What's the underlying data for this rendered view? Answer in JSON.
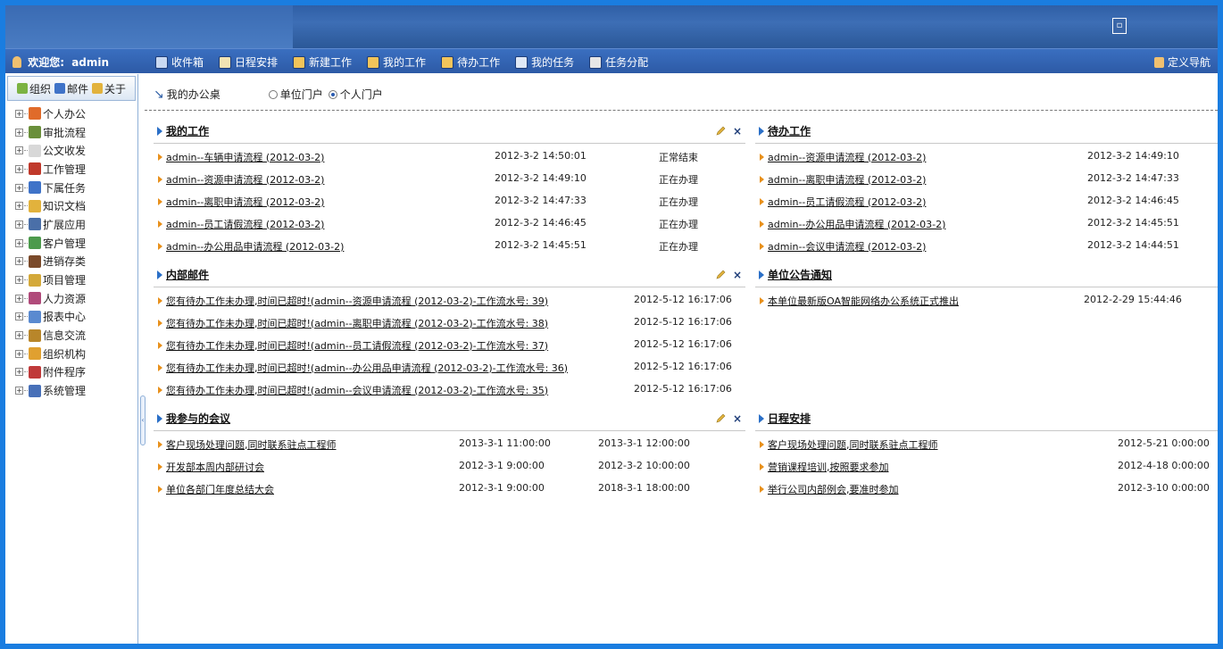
{
  "header": {
    "window_btn": "▫"
  },
  "nav": {
    "welcome": "欢迎您:",
    "user": "admin",
    "items": [
      {
        "label": "收件箱",
        "icon": "inbox-icon",
        "color": "#c9d9f2"
      },
      {
        "label": "日程安排",
        "icon": "calendar-icon",
        "color": "#f2e3b3"
      },
      {
        "label": "新建工作",
        "icon": "new-work-icon",
        "color": "#f2c45a"
      },
      {
        "label": "我的工作",
        "icon": "my-work-icon",
        "color": "#f2c45a"
      },
      {
        "label": "待办工作",
        "icon": "todo-icon",
        "color": "#f2c45a"
      },
      {
        "label": "我的任务",
        "icon": "task-icon",
        "color": "#dfe8f6"
      },
      {
        "label": "任务分配",
        "icon": "assign-icon",
        "color": "#e6e6e6"
      }
    ],
    "custom_nav": "定义导航"
  },
  "sidebar": {
    "tabs": [
      {
        "label": "组织",
        "icon": "org-icon"
      },
      {
        "label": "邮件",
        "icon": "mail-icon"
      },
      {
        "label": "关于",
        "icon": "about-icon"
      }
    ],
    "tree": [
      {
        "label": "个人办公",
        "color": "#e06b2a"
      },
      {
        "label": "审批流程",
        "color": "#6a8f3a"
      },
      {
        "label": "公文收发",
        "color": "#d8d8d8"
      },
      {
        "label": "工作管理",
        "color": "#c0392b"
      },
      {
        "label": "下属任务",
        "color": "#3f73c8"
      },
      {
        "label": "知识文档",
        "color": "#e2b23c"
      },
      {
        "label": "扩展应用",
        "color": "#4a6fa8"
      },
      {
        "label": "客户管理",
        "color": "#4c9a4c"
      },
      {
        "label": "进销存类",
        "color": "#7a4a2a"
      },
      {
        "label": "项目管理",
        "color": "#d4a93a"
      },
      {
        "label": "人力资源",
        "color": "#b04a7a"
      },
      {
        "label": "报表中心",
        "color": "#5a8ad0"
      },
      {
        "label": "信息交流",
        "color": "#b8862a"
      },
      {
        "label": "组织机构",
        "color": "#e0a030"
      },
      {
        "label": "附件程序",
        "color": "#c03a3a"
      },
      {
        "label": "系统管理",
        "color": "#4870b8"
      }
    ]
  },
  "main": {
    "desk_label": "我的办公桌",
    "radio_unit": "单位门户",
    "radio_personal": "个人门户"
  },
  "panels": {
    "my_work": {
      "title": "我的工作",
      "rows": [
        {
          "title": "admin--车辆申请流程 (2012-03-2)",
          "time": "2012-3-2 14:50:01",
          "status": "正常结束"
        },
        {
          "title": "admin--资源申请流程 (2012-03-2)",
          "time": "2012-3-2 14:49:10",
          "status": "正在办理"
        },
        {
          "title": "admin--离职申请流程 (2012-03-2)",
          "time": "2012-3-2 14:47:33",
          "status": "正在办理"
        },
        {
          "title": "admin--员工请假流程 (2012-03-2)",
          "time": "2012-3-2 14:46:45",
          "status": "正在办理"
        },
        {
          "title": "admin--办公用品申请流程 (2012-03-2)",
          "time": "2012-3-2 14:45:51",
          "status": "正在办理"
        }
      ]
    },
    "todo_work": {
      "title": "待办工作",
      "rows": [
        {
          "title": "admin--资源申请流程 (2012-03-2)",
          "time": "2012-3-2 14:49:10"
        },
        {
          "title": "admin--离职申请流程 (2012-03-2)",
          "time": "2012-3-2 14:47:33"
        },
        {
          "title": "admin--员工请假流程 (2012-03-2)",
          "time": "2012-3-2 14:46:45"
        },
        {
          "title": "admin--办公用品申请流程 (2012-03-2)",
          "time": "2012-3-2 14:45:51"
        },
        {
          "title": "admin--会议申请流程 (2012-03-2)",
          "time": "2012-3-2 14:44:51"
        }
      ]
    },
    "internal_mail": {
      "title": "内部邮件",
      "rows": [
        {
          "title": "您有待办工作未办理,时间已超时!(admin--资源申请流程 (2012-03-2)-工作流水号: 39)",
          "time": "2012-5-12 16:17:06"
        },
        {
          "title": "您有待办工作未办理,时间已超时!(admin--离职申请流程 (2012-03-2)-工作流水号: 38)",
          "time": "2012-5-12 16:17:06"
        },
        {
          "title": "您有待办工作未办理,时间已超时!(admin--员工请假流程 (2012-03-2)-工作流水号: 37)",
          "time": "2012-5-12 16:17:06"
        },
        {
          "title": "您有待办工作未办理,时间已超时!(admin--办公用品申请流程 (2012-03-2)-工作流水号: 36)",
          "time": "2012-5-12 16:17:06"
        },
        {
          "title": "您有待办工作未办理,时间已超时!(admin--会议申请流程 (2012-03-2)-工作流水号: 35)",
          "time": "2012-5-12 16:17:06"
        }
      ]
    },
    "notice": {
      "title": "单位公告通知",
      "rows": [
        {
          "title": "本单位最新版OA智能网络办公系统正式推出",
          "time": "2012-2-29 15:44:46"
        }
      ]
    },
    "meetings": {
      "title": "我参与的会议",
      "rows": [
        {
          "title": "客户现场处理问题,同时联系驻点工程师",
          "start": "2013-3-1 11:00:00",
          "end": "2013-3-1 12:00:00"
        },
        {
          "title": "开发部本周内部研讨会",
          "start": "2012-3-1 9:00:00",
          "end": "2012-3-2 10:00:00"
        },
        {
          "title": "单位各部门年度总结大会",
          "start": "2012-3-1 9:00:00",
          "end": "2018-3-1 18:00:00"
        }
      ]
    },
    "schedule": {
      "title": "日程安排",
      "rows": [
        {
          "title": "客户现场处理问题,同时联系驻点工程师",
          "time": "2012-5-21 0:00:00"
        },
        {
          "title": "营销课程培训,按照要求参加",
          "time": "2012-4-18 0:00:00"
        },
        {
          "title": "举行公司内部例会,要准时参加",
          "time": "2012-3-10 0:00:00"
        }
      ]
    }
  },
  "colors": {
    "accent": "#2f5fa6",
    "frame": "#1a7de0",
    "bullet": "#e8901b"
  }
}
